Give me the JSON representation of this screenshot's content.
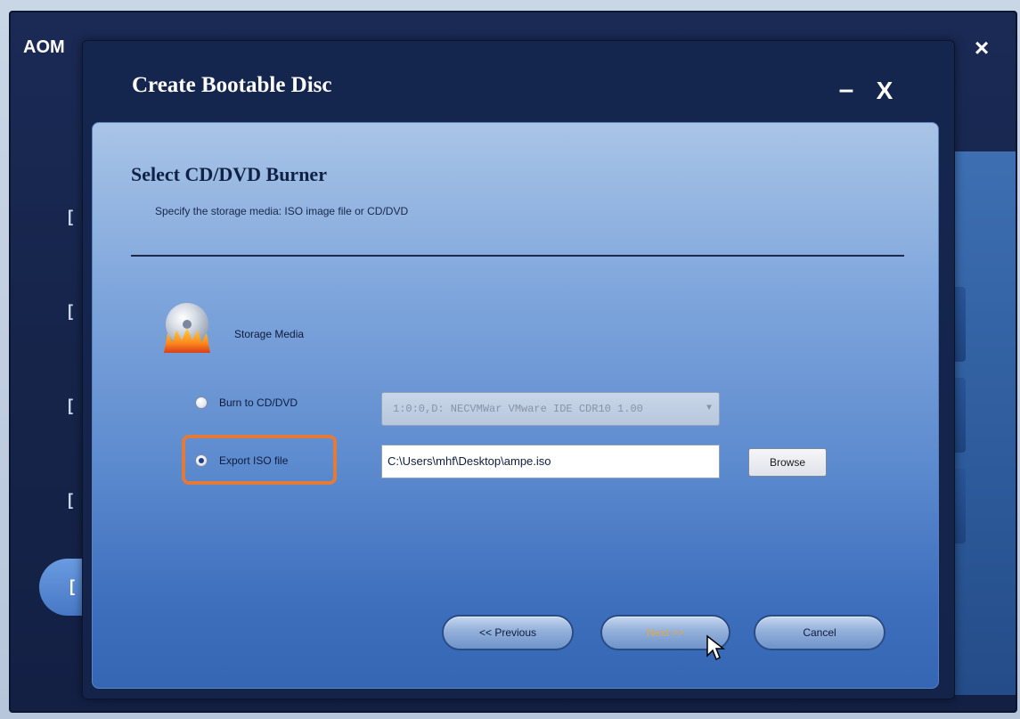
{
  "parent_window": {
    "title": "AOM",
    "close_label": "×"
  },
  "dialog": {
    "title": "Create Bootable Disc",
    "minimize_label": "–",
    "close_label": "X"
  },
  "section": {
    "title": "Select CD/DVD Burner",
    "subtitle": "Specify the storage media: ISO image file or CD/DVD"
  },
  "storage_media": {
    "label": "Storage Media",
    "icon": "burning-disc-icon"
  },
  "options": {
    "burn": {
      "label": "Burn to CD/DVD",
      "selected": false,
      "drive_value": "1:0:0,D: NECVMWar VMware IDE CDR10 1.00"
    },
    "export": {
      "label": "Export ISO file",
      "selected": true,
      "path_value": "C:\\Users\\mhf\\Desktop\\ampe.iso",
      "browse_label": "Browse"
    }
  },
  "navigation": {
    "previous_label": "<< Previous",
    "next_label": "Next >>",
    "cancel_label": "Cancel"
  },
  "colors": {
    "highlight": "#e27a3a",
    "dialog_bg": "#15264e",
    "content_top": "#a9c4e6",
    "content_bottom": "#3566b3"
  }
}
